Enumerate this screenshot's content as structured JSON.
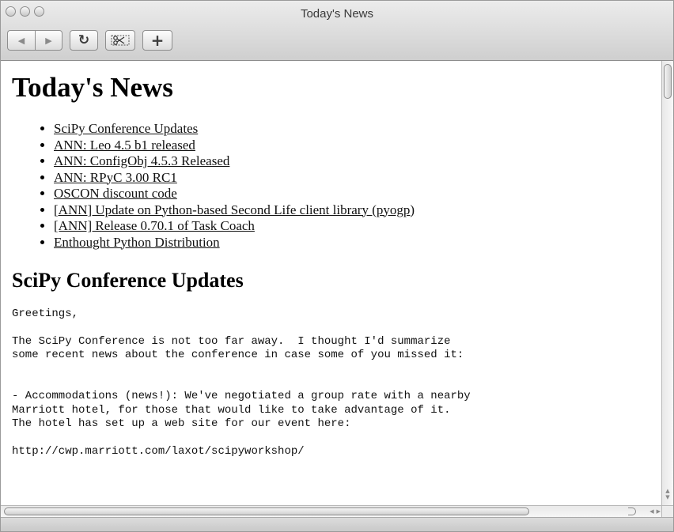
{
  "window": {
    "title": "Today's News"
  },
  "toolbar": {
    "back_icon": "◀",
    "forward_icon": "▶",
    "reload_icon": "↻",
    "clip_icon": "✂",
    "add_icon": "+"
  },
  "page": {
    "heading": "Today's News",
    "news_items": [
      "SciPy Conference Updates",
      "ANN: Leo 4.5 b1 released",
      "ANN: ConfigObj 4.5.3 Released",
      "ANN: RPyC 3.00 RC1",
      "OSCON discount code",
      "[ANN] Update on Python-based Second Life client library (pyogp)",
      "[ANN] Release 0.70.1 of Task Coach",
      "Enthought Python Distribution"
    ],
    "section_heading": "SciPy Conference Updates",
    "article_text": "Greetings,\n\nThe SciPy Conference is not too far away.  I thought I'd summarize\nsome recent news about the conference in case some of you missed it:\n\n\n- Accommodations (news!): We've negotiated a group rate with a nearby\nMarriott hotel, for those that would like to take advantage of it.\nThe hotel has set up a web site for our event here:\n\nhttp://cwp.marriott.com/laxot/scipyworkshop/"
  }
}
